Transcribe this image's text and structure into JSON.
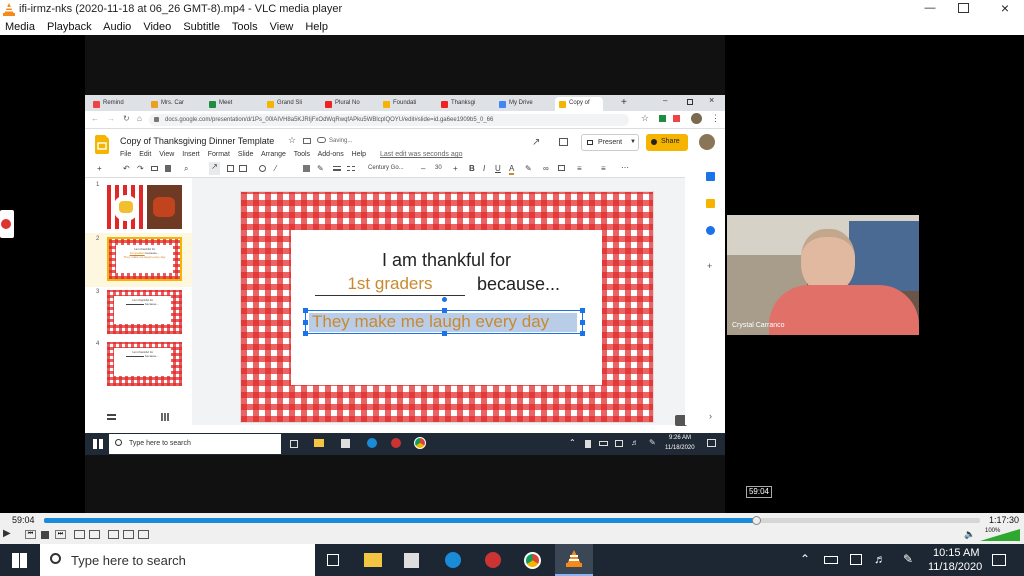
{
  "window": {
    "title": "ifi-irmz-nks (2020-11-18 at 06_26 GMT-8).mp4 - VLC media player"
  },
  "menu": [
    "Media",
    "Playback",
    "Audio",
    "Video",
    "Subtitle",
    "Tools",
    "View",
    "Help"
  ],
  "browser": {
    "tabs": [
      "Remind",
      "Mrs. Car",
      "Meet",
      "Grand Sli",
      "Plural No",
      "Foundati",
      "Thanksgi",
      "My Drive",
      "Copy of"
    ],
    "url": "docs.google.com/presentation/d/1Ps_00lAIVH8a5KJRIjFxOdWqRwqfAPku5WBlcplQOYU/edit#slide=id.ga6ee1909b5_0_66"
  },
  "docs": {
    "title": "Copy of Thanksgiving Dinner Template",
    "saving": "Saving...",
    "menu": [
      "File",
      "Edit",
      "View",
      "Insert",
      "Format",
      "Slide",
      "Arrange",
      "Tools",
      "Add-ons",
      "Help"
    ],
    "last_edit": "Last edit was seconds ago",
    "present": "Present",
    "share": "Share",
    "font": "Century Go...",
    "font_size": "30"
  },
  "slides": [
    {
      "num": "1"
    },
    {
      "num": "2",
      "line1": "I am thankful for",
      "line2": "1st graders",
      "line3": "because...",
      "line4": "They make me laugh every day"
    },
    {
      "num": "3",
      "line1": "I am thankful for",
      "line3": "because..."
    },
    {
      "num": "4",
      "line1": "I am thankful for",
      "line3": "because..."
    }
  ],
  "main_slide": {
    "line1": "I am thankful for",
    "blank": "1st graders",
    "because": "because...",
    "selected": "They make me laugh every day"
  },
  "windows_inner": {
    "search": "Type here to search",
    "time": "9:26 AM",
    "date": "11/18/2020"
  },
  "webcam": {
    "name": "Crystal Carranco"
  },
  "player": {
    "tooltip": "59:04",
    "elapsed": "59:04",
    "total": "1:17:30",
    "volume": "100%",
    "progress": 0.762
  },
  "taskbar": {
    "search": "Type here to search",
    "time": "10:15 AM",
    "date": "11/18/2020"
  },
  "colors": {
    "accent": "#e8a21f",
    "vlc_orange": "#f48a1b",
    "progress": "#1a8bd8",
    "gingham": "#e12828",
    "blank_text": "#c9892f"
  }
}
